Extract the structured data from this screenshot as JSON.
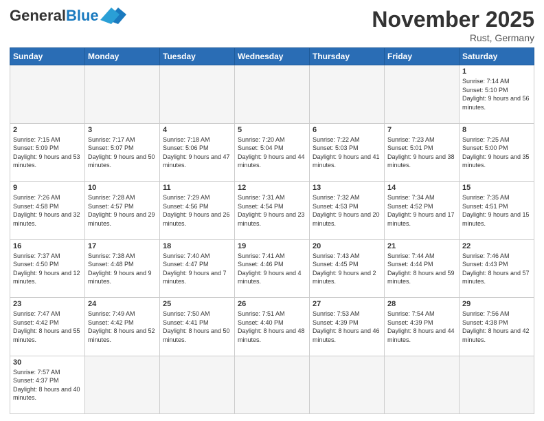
{
  "header": {
    "logo_general": "General",
    "logo_blue": "Blue",
    "month_title": "November 2025",
    "location": "Rust, Germany"
  },
  "weekdays": [
    "Sunday",
    "Monday",
    "Tuesday",
    "Wednesday",
    "Thursday",
    "Friday",
    "Saturday"
  ],
  "weeks": [
    [
      {
        "day": "",
        "info": ""
      },
      {
        "day": "",
        "info": ""
      },
      {
        "day": "",
        "info": ""
      },
      {
        "day": "",
        "info": ""
      },
      {
        "day": "",
        "info": ""
      },
      {
        "day": "",
        "info": ""
      },
      {
        "day": "1",
        "info": "Sunrise: 7:14 AM\nSunset: 5:10 PM\nDaylight: 9 hours and 56 minutes."
      }
    ],
    [
      {
        "day": "2",
        "info": "Sunrise: 7:15 AM\nSunset: 5:09 PM\nDaylight: 9 hours and 53 minutes."
      },
      {
        "day": "3",
        "info": "Sunrise: 7:17 AM\nSunset: 5:07 PM\nDaylight: 9 hours and 50 minutes."
      },
      {
        "day": "4",
        "info": "Sunrise: 7:18 AM\nSunset: 5:06 PM\nDaylight: 9 hours and 47 minutes."
      },
      {
        "day": "5",
        "info": "Sunrise: 7:20 AM\nSunset: 5:04 PM\nDaylight: 9 hours and 44 minutes."
      },
      {
        "day": "6",
        "info": "Sunrise: 7:22 AM\nSunset: 5:03 PM\nDaylight: 9 hours and 41 minutes."
      },
      {
        "day": "7",
        "info": "Sunrise: 7:23 AM\nSunset: 5:01 PM\nDaylight: 9 hours and 38 minutes."
      },
      {
        "day": "8",
        "info": "Sunrise: 7:25 AM\nSunset: 5:00 PM\nDaylight: 9 hours and 35 minutes."
      }
    ],
    [
      {
        "day": "9",
        "info": "Sunrise: 7:26 AM\nSunset: 4:58 PM\nDaylight: 9 hours and 32 minutes."
      },
      {
        "day": "10",
        "info": "Sunrise: 7:28 AM\nSunset: 4:57 PM\nDaylight: 9 hours and 29 minutes."
      },
      {
        "day": "11",
        "info": "Sunrise: 7:29 AM\nSunset: 4:56 PM\nDaylight: 9 hours and 26 minutes."
      },
      {
        "day": "12",
        "info": "Sunrise: 7:31 AM\nSunset: 4:54 PM\nDaylight: 9 hours and 23 minutes."
      },
      {
        "day": "13",
        "info": "Sunrise: 7:32 AM\nSunset: 4:53 PM\nDaylight: 9 hours and 20 minutes."
      },
      {
        "day": "14",
        "info": "Sunrise: 7:34 AM\nSunset: 4:52 PM\nDaylight: 9 hours and 17 minutes."
      },
      {
        "day": "15",
        "info": "Sunrise: 7:35 AM\nSunset: 4:51 PM\nDaylight: 9 hours and 15 minutes."
      }
    ],
    [
      {
        "day": "16",
        "info": "Sunrise: 7:37 AM\nSunset: 4:50 PM\nDaylight: 9 hours and 12 minutes."
      },
      {
        "day": "17",
        "info": "Sunrise: 7:38 AM\nSunset: 4:48 PM\nDaylight: 9 hours and 9 minutes."
      },
      {
        "day": "18",
        "info": "Sunrise: 7:40 AM\nSunset: 4:47 PM\nDaylight: 9 hours and 7 minutes."
      },
      {
        "day": "19",
        "info": "Sunrise: 7:41 AM\nSunset: 4:46 PM\nDaylight: 9 hours and 4 minutes."
      },
      {
        "day": "20",
        "info": "Sunrise: 7:43 AM\nSunset: 4:45 PM\nDaylight: 9 hours and 2 minutes."
      },
      {
        "day": "21",
        "info": "Sunrise: 7:44 AM\nSunset: 4:44 PM\nDaylight: 8 hours and 59 minutes."
      },
      {
        "day": "22",
        "info": "Sunrise: 7:46 AM\nSunset: 4:43 PM\nDaylight: 8 hours and 57 minutes."
      }
    ],
    [
      {
        "day": "23",
        "info": "Sunrise: 7:47 AM\nSunset: 4:42 PM\nDaylight: 8 hours and 55 minutes."
      },
      {
        "day": "24",
        "info": "Sunrise: 7:49 AM\nSunset: 4:42 PM\nDaylight: 8 hours and 52 minutes."
      },
      {
        "day": "25",
        "info": "Sunrise: 7:50 AM\nSunset: 4:41 PM\nDaylight: 8 hours and 50 minutes."
      },
      {
        "day": "26",
        "info": "Sunrise: 7:51 AM\nSunset: 4:40 PM\nDaylight: 8 hours and 48 minutes."
      },
      {
        "day": "27",
        "info": "Sunrise: 7:53 AM\nSunset: 4:39 PM\nDaylight: 8 hours and 46 minutes."
      },
      {
        "day": "28",
        "info": "Sunrise: 7:54 AM\nSunset: 4:39 PM\nDaylight: 8 hours and 44 minutes."
      },
      {
        "day": "29",
        "info": "Sunrise: 7:56 AM\nSunset: 4:38 PM\nDaylight: 8 hours and 42 minutes."
      }
    ],
    [
      {
        "day": "30",
        "info": "Sunrise: 7:57 AM\nSunset: 4:37 PM\nDaylight: 8 hours and 40 minutes."
      },
      {
        "day": "",
        "info": ""
      },
      {
        "day": "",
        "info": ""
      },
      {
        "day": "",
        "info": ""
      },
      {
        "day": "",
        "info": ""
      },
      {
        "day": "",
        "info": ""
      },
      {
        "day": "",
        "info": ""
      }
    ]
  ]
}
